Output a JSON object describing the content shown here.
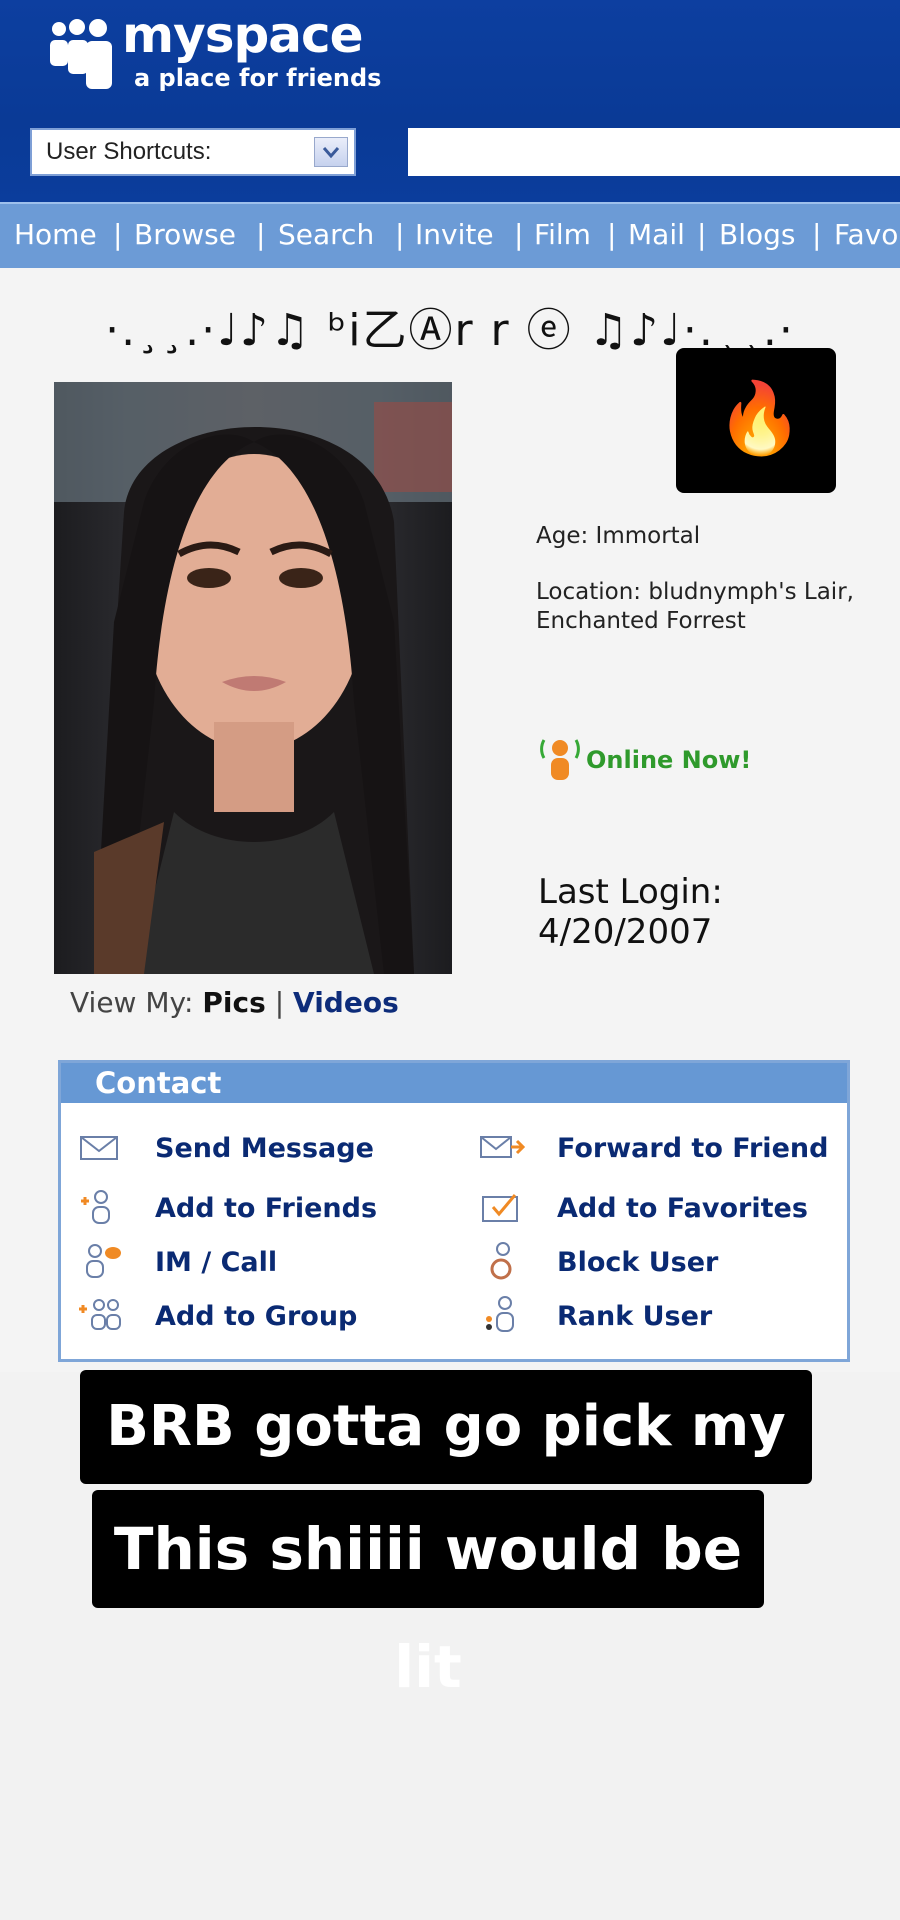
{
  "header": {
    "logo_text": "myspace",
    "tagline": "a place for friends",
    "shortcuts_label": "User Shortcuts:",
    "search_value": ""
  },
  "nav": {
    "items": [
      "Home",
      "Browse",
      "Search",
      "Invite",
      "Film",
      "Mail",
      "Blogs",
      "Favo"
    ]
  },
  "profile": {
    "name": "·.¸¸.·♩♪♫ ᵇi乙Ⓐr r ⓔ ♫♪♩·.¸¸.·",
    "fire_emoji": "🔥",
    "age": "Age: Immortal",
    "location_line1": "Location: bludnymph's Lair,",
    "location_line2": "Enchanted Forrest",
    "online_status": "Online Now!",
    "last_login_label": "Last Login:",
    "last_login_date": "4/20/2007",
    "view_my_label": "View My:",
    "pics_link": "Pics",
    "divider": "|",
    "videos_link": "Videos"
  },
  "contact": {
    "title": "Contact",
    "send_message": "Send Message",
    "forward_to_friend": "Forward to Friend",
    "add_to_friends": "Add to Friends",
    "add_to_favorites": "Add to Favorites",
    "im_call": "IM / Call",
    "block_user": "Block User",
    "add_to_group": "Add to Group",
    "rank_user": "Rank User"
  },
  "captions": {
    "line1": "BRB gotta go pick my song",
    "line2": "This shiiii would be lit"
  },
  "colors": {
    "header_blue": "#0d3fa0",
    "nav_blue": "#6c9bd6",
    "link_navy": "#0a2a73",
    "online_green": "#2f9a2c"
  }
}
